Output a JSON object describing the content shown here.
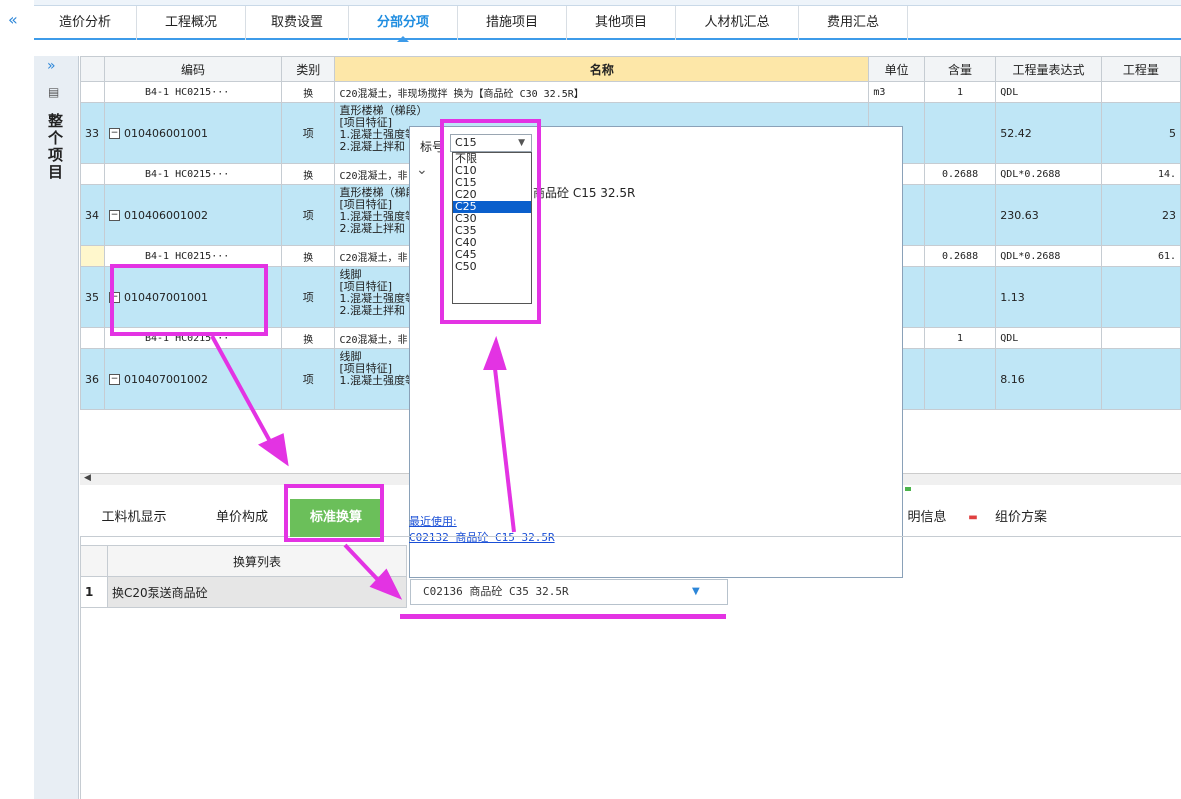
{
  "top_tabs": [
    "造价分析",
    "工程概况",
    "取费设置",
    "分部分项",
    "措施项目",
    "其他项目",
    "人材机汇总",
    "费用汇总"
  ],
  "active_tab": "分部分项",
  "side_panel": {
    "label": "整个项目"
  },
  "grid": {
    "headers": {
      "code": "编码",
      "type": "类别",
      "name": "名称",
      "unit": "单位",
      "content": "含量",
      "expr": "工程量表达式",
      "qty": "工程量"
    },
    "rows": [
      {
        "kind": "sub",
        "num": "",
        "code": "B4-1 HC0215···",
        "type": "换",
        "name": "C20混凝土，非现场搅拌  换为【商品砼 C30 32.5R】",
        "unit": "m3",
        "content": "1",
        "expr": "QDL",
        "qty": ""
      },
      {
        "kind": "item",
        "num": "33",
        "code": "010406001001",
        "type": "项",
        "name": "直形楼梯（梯段）\n[项目特征]\n1.混凝土强度等\n2.混凝上拌和",
        "unit": "",
        "content": "",
        "expr": "52.42",
        "qty": "5"
      },
      {
        "kind": "sub",
        "num": "",
        "code": "B4-1 HC0215···",
        "type": "换",
        "name": "C20混凝土，非",
        "unit": "",
        "content": "0.2688",
        "expr": "QDL*0.2688",
        "qty": "14."
      },
      {
        "kind": "item",
        "num": "34",
        "code": "010406001002",
        "type": "项",
        "name": "直形楼梯（梯段\n[项目特征]\n1.混凝土强度等\n2.混凝上拌和",
        "unit": "",
        "content": "",
        "expr": "230.63",
        "qty": "23"
      },
      {
        "kind": "sub",
        "num": "",
        "code": "B4-1 HC0215···",
        "type": "换",
        "name": "C20混凝土，非",
        "unit": "",
        "content": "0.2688",
        "expr": "QDL*0.2688",
        "qty": "61."
      },
      {
        "kind": "item",
        "num": "35",
        "code": "010407001001",
        "type": "项",
        "name": "线脚\n[项目特征]\n1.混凝土强度等\n2.混凝土拌和",
        "unit": "",
        "content": "",
        "expr": "1.13",
        "qty": ""
      },
      {
        "kind": "sub",
        "num": "",
        "code": "B4-1 HC0215···",
        "type": "换",
        "name": "C20混凝土，非",
        "unit": "",
        "content": "1",
        "expr": "QDL",
        "qty": ""
      },
      {
        "kind": "item",
        "num": "36",
        "code": "010407001002",
        "type": "项",
        "name": "线脚\n[项目特征]\n1.混凝土强度等",
        "unit": "",
        "content": "",
        "expr": "8.16",
        "qty": ""
      }
    ]
  },
  "popup": {
    "label": "标号",
    "selected": "C15",
    "options": [
      "不限",
      "C10",
      "C15",
      "C20",
      "C25",
      "C30",
      "C35",
      "C40",
      "C45",
      "C50"
    ],
    "highlighted": "C25",
    "tree_item": "商品砼 C15 32.5R",
    "recent_label": "最近使用:",
    "recent_item": "C02132 商品砼 C15 32.5R"
  },
  "bottom_tabs": {
    "t1": "工料机显示",
    "t2": "单价构成",
    "t3": "标准换算",
    "t4": "明信息",
    "t5": "组价方案"
  },
  "conversion_table": {
    "header": "换算列表",
    "rows": [
      {
        "num": "1",
        "name": "换C20泵送商品砼"
      }
    ],
    "combo_value": "C02136  商品砼 C35 32.5R"
  },
  "colors": {
    "accent": "#3d9be9",
    "annotation": "#e333e3",
    "row_highlight": "#bfe6f6",
    "std_tab": "#6bbf5a"
  }
}
